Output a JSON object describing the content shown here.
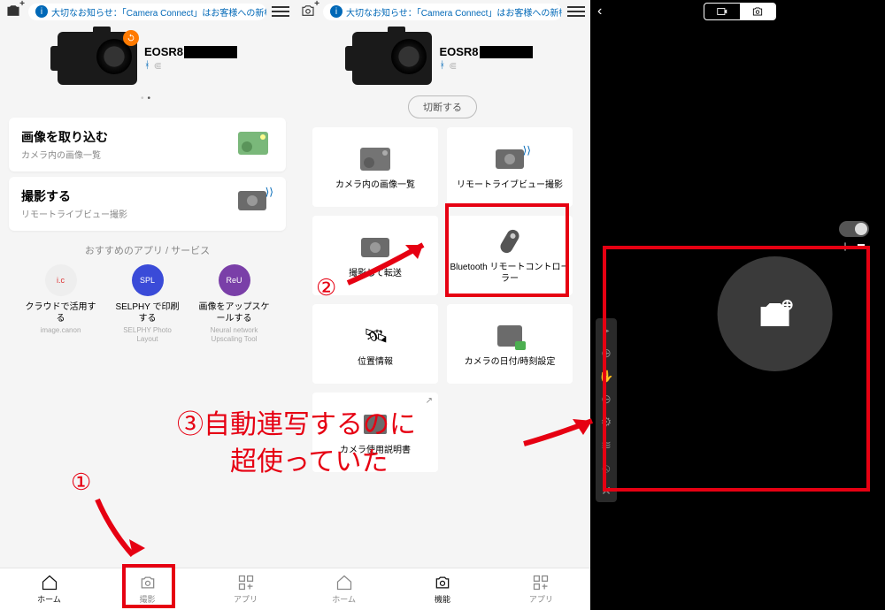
{
  "notice": "大切なお知らせ：「Camera Connect」はお客様への新機...",
  "camera": {
    "name_prefix": "EOSR8",
    "bluetooth": true,
    "wifi": false
  },
  "disconnect_label": "切断する",
  "panel1": {
    "cards": [
      {
        "title": "画像を取り込む",
        "subtitle": "カメラ内の画像一覧"
      },
      {
        "title": "撮影する",
        "subtitle": "リモートライブビュー撮影"
      }
    ],
    "rec_title": "おすすめのアプリ / サービス",
    "rec_items": [
      {
        "badge": "i.c",
        "title": "クラウドで活用する",
        "sub": "image.canon"
      },
      {
        "badge": "SPL",
        "title": "SELPHY で印刷する",
        "sub": "SELPHY Photo Layout"
      },
      {
        "badge": "ReU",
        "title": "画像をアップスケールする",
        "sub": "Neural network Upscaling Tool"
      }
    ],
    "tabs": [
      {
        "label": "ホーム"
      },
      {
        "label": "撮影"
      },
      {
        "label": "アプリ"
      }
    ]
  },
  "panel2": {
    "tiles": [
      {
        "label": "カメラ内の画像一覧"
      },
      {
        "label": "リモートライブビュー撮影"
      },
      {
        "label": "撮影して転送"
      },
      {
        "label": "Bluetooth リモートコントローラー"
      },
      {
        "label": "位置情報"
      },
      {
        "label": "カメラの日付/時刻設定"
      },
      {
        "label": "カメラ使用説明書"
      }
    ],
    "tabs": [
      {
        "label": "ホーム"
      },
      {
        "label": "機能"
      },
      {
        "label": "アプリ"
      }
    ]
  },
  "panel3": {
    "segments": [
      "video",
      "photo"
    ],
    "tools": [
      "play",
      "plus",
      "hand",
      "minus",
      "gear",
      "wave",
      "eye-off",
      "close"
    ]
  },
  "annotations": {
    "num1": "①",
    "num2": "②",
    "num3_line1": "③自動連写するのに",
    "num3_line2": "超使っていた"
  }
}
